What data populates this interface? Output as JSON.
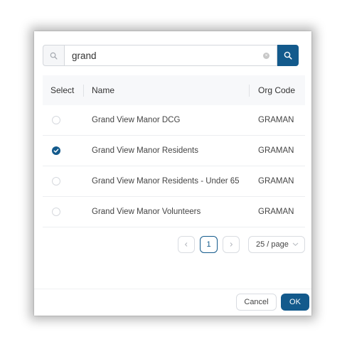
{
  "search": {
    "value": "grand",
    "placeholder": "",
    "icon": "search-icon",
    "clear_icon": "clear-icon",
    "button_icon": "search-icon"
  },
  "table": {
    "columns": [
      "Select",
      "Name",
      "Org Code"
    ],
    "rows": [
      {
        "name": "Grand View Manor DCG",
        "org_code": "GRAMAN",
        "selected": false
      },
      {
        "name": "Grand View Manor Residents",
        "org_code": "GRAMAN",
        "selected": true
      },
      {
        "name": "Grand View Manor Residents - Under 65",
        "org_code": "GRAMAN",
        "selected": false
      },
      {
        "name": "Grand View Manor Volunteers",
        "org_code": "GRAMAN",
        "selected": false
      }
    ]
  },
  "pagination": {
    "current_page": "1",
    "page_size": "25 / page"
  },
  "footer": {
    "cancel_label": "Cancel",
    "ok_label": "OK"
  },
  "colors": {
    "accent": "#135a8c",
    "header_bg": "#f7f8fa",
    "border": "#d9dce1"
  }
}
